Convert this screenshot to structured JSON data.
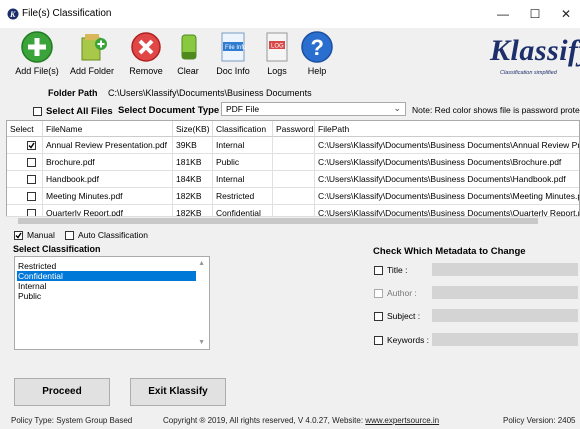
{
  "window": {
    "title": "File(s) Classification",
    "minimize": "—",
    "maximize": "☐",
    "close": "✕"
  },
  "toolbar": {
    "add_files": "Add File(s)",
    "add_folder": "Add Folder",
    "remove": "Remove",
    "clear": "Clear",
    "doc_info": "Doc Info",
    "logs": "Logs",
    "help": "Help",
    "doc_info_icon_text": "File Info",
    "logs_icon_text": "LOG"
  },
  "logo": {
    "text": "Klassify",
    "tagline": "Classification simplified"
  },
  "folder": {
    "label": "Folder Path",
    "value": "C:\\Users\\Klassify\\Documents\\Business Documents"
  },
  "select_all_label": "Select All Files",
  "doc_type": {
    "label": "Select Document Type",
    "value": "PDF File"
  },
  "note": "Note: Red color shows file is password protected",
  "grid": {
    "columns": [
      "Select",
      "FileName",
      "Size(KB)",
      "Classification",
      "Password",
      "FilePath"
    ],
    "rows": [
      {
        "checked": true,
        "filename": "Annual Review Presentation.pdf",
        "size": "39KB",
        "classification": "Internal",
        "password": "",
        "path": "C:\\Users\\Klassify\\Documents\\Business Documents\\Annual Review Presen"
      },
      {
        "checked": false,
        "filename": "Brochure.pdf",
        "size": "181KB",
        "classification": "Public",
        "password": "",
        "path": "C:\\Users\\Klassify\\Documents\\Business Documents\\Brochure.pdf"
      },
      {
        "checked": false,
        "filename": "Handbook.pdf",
        "size": "184KB",
        "classification": "Internal",
        "password": "",
        "path": "C:\\Users\\Klassify\\Documents\\Business Documents\\Handbook.pdf"
      },
      {
        "checked": false,
        "filename": "Meeting Minutes.pdf",
        "size": "182KB",
        "classification": "Restricted",
        "password": "",
        "path": "C:\\Users\\Klassify\\Documents\\Business Documents\\Meeting Minutes.pdf"
      },
      {
        "checked": false,
        "filename": "Quarterly Report.pdf",
        "size": "182KB",
        "classification": "Confidential",
        "password": "",
        "path": "C:\\Users\\Klassify\\Documents\\Business Documents\\Quarterly Report.pdf"
      }
    ]
  },
  "mode": {
    "manual_label": "Manual",
    "manual_checked": true,
    "auto_label": "Auto Classification",
    "auto_checked": false
  },
  "classification": {
    "label": "Select Classification",
    "options": [
      "Restricted",
      "Confidential",
      "Internal",
      "Public"
    ],
    "selected": "Confidential"
  },
  "metadata": {
    "label": "Check Which Metadata to Change",
    "title_label": "Title :",
    "author_label": "Author :",
    "subject_label": "Subject :",
    "keywords_label": "Keywords :"
  },
  "buttons": {
    "proceed": "Proceed",
    "exit": "Exit Klassify"
  },
  "footer": {
    "policy_type": "Policy Type: System Group Based",
    "copyright": "Copyright ® 2019, All rights reserved, V 4.0.27, Website: ",
    "website": "www.expertsource.in",
    "policy_version": "Policy Version: 2405"
  },
  "colors": {
    "selection": "#0078d7",
    "logo_blue": "#1d2f6b",
    "row_alt": "#ffffff"
  }
}
